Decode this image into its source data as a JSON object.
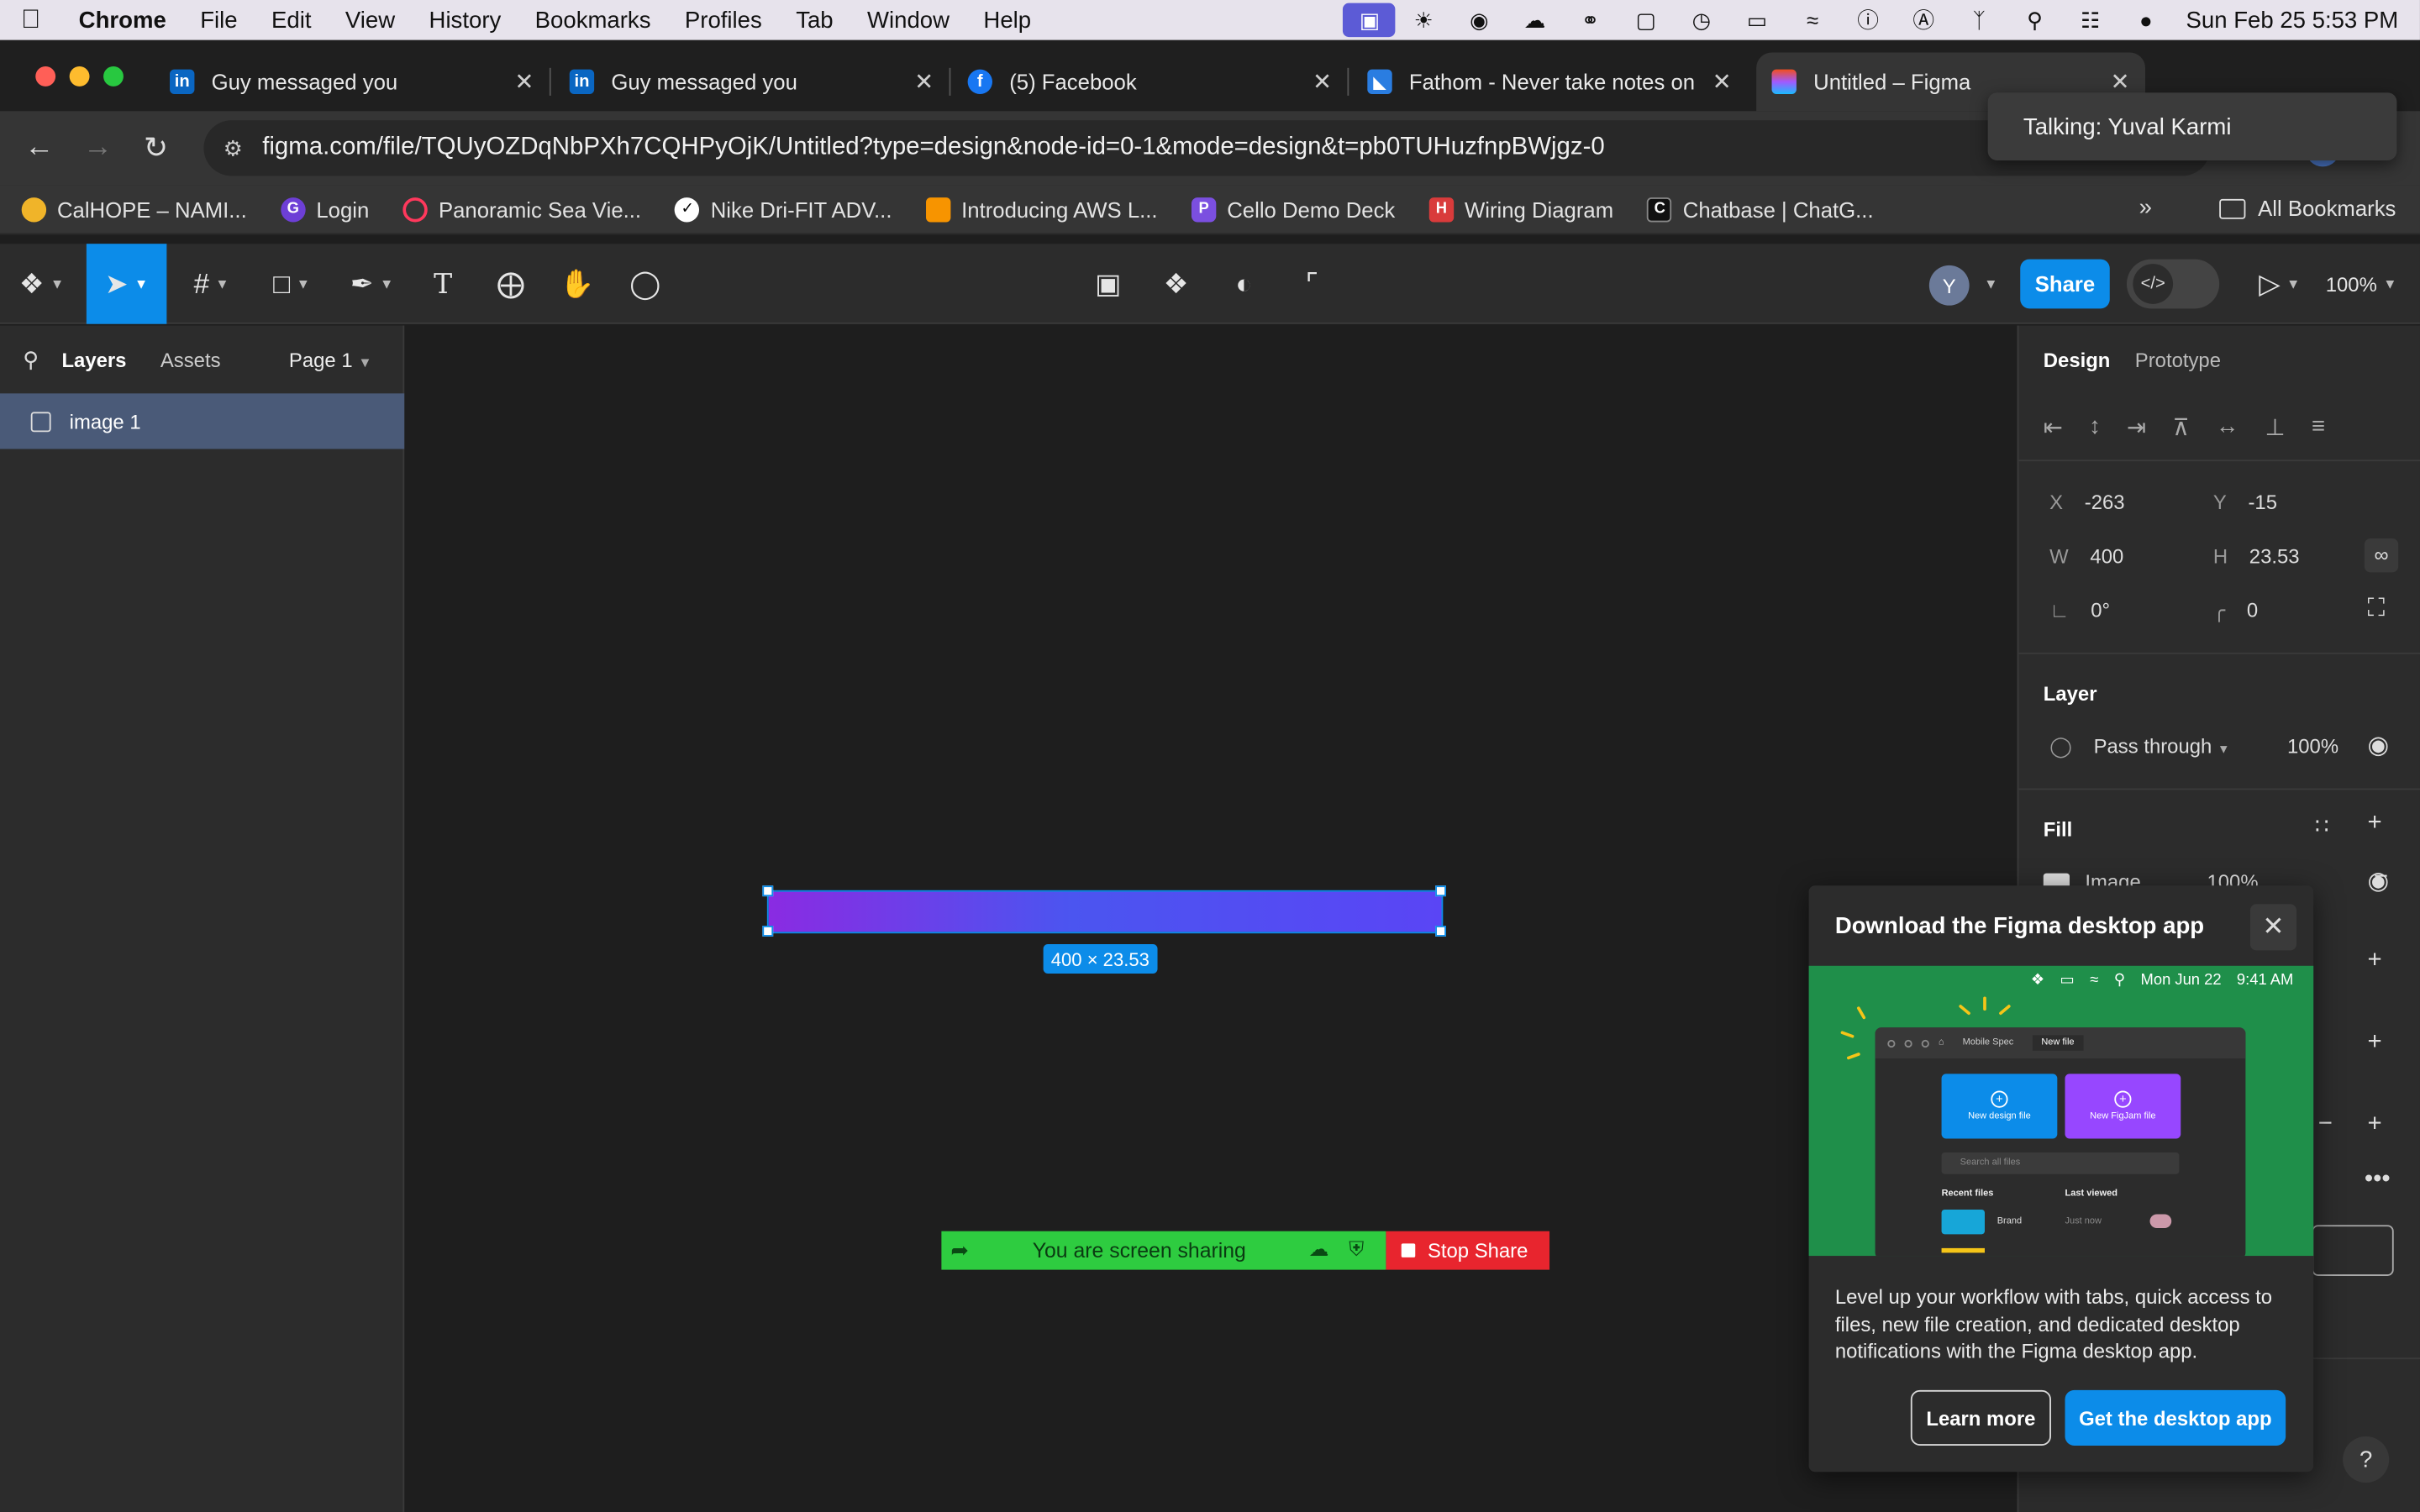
{
  "menubar": {
    "app": "Chrome",
    "items": [
      "File",
      "Edit",
      "View",
      "History",
      "Bookmarks",
      "Profiles",
      "Tab",
      "Window",
      "Help"
    ],
    "clock": "Sun Feb 25  5:53 PM",
    "tray_icons": [
      "screen-share-icon",
      "sun-icon",
      "fathom-icon",
      "weather-icon",
      "headphones-icon",
      "square-icon",
      "clock-icon",
      "battery-icon",
      "wifi-icon",
      "info-icon",
      "keyboard-a-icon",
      "bluetooth-icon",
      "search-icon",
      "control-center-icon",
      "siri-icon"
    ]
  },
  "tabs": [
    {
      "title": "Guy messaged you",
      "favicon": "linkedin-icon",
      "color": "#0a66c2"
    },
    {
      "title": "Guy messaged you",
      "favicon": "linkedin-icon",
      "color": "#0a66c2"
    },
    {
      "title": "(5) Facebook",
      "favicon": "facebook-icon",
      "color": "#1877f2"
    },
    {
      "title": "Fathom - Never take notes on",
      "favicon": "fathom-icon",
      "color": "#2a7de1"
    },
    {
      "title": "Untitled – Figma",
      "favicon": "figma-icon",
      "color": "#f24e1e"
    }
  ],
  "address": {
    "url": "figma.com/file/TQUyOZDqNbPXh7CQHPyOjK/Untitled?type=design&node-id=0-1&mode=design&t=pb0TUHuzfnpBWjgz-0"
  },
  "bookmarks": {
    "items": [
      {
        "label": "CalHOPE – NAMI...",
        "color": "#f0b429"
      },
      {
        "label": "Login",
        "color": "#6d3fd6"
      },
      {
        "label": "Panoramic Sea Vie...",
        "color": "#ff385c"
      },
      {
        "label": "Nike Dri-FIT ADV...",
        "color": "#ffffff"
      },
      {
        "label": "Introducing AWS L...",
        "color": "#f79400"
      },
      {
        "label": "Cello Demo Deck",
        "color": "#7b4fe0"
      },
      {
        "label": "Wiring Diagram",
        "color": "#d93b3b"
      },
      {
        "label": "Chatbase | ChatG...",
        "color": "#111111"
      }
    ],
    "overflow": "»",
    "all_bookmarks": "All Bookmarks"
  },
  "toast": {
    "text": "Talking: Yuval Karmi"
  },
  "figma_toolbar": {
    "share_label": "Share",
    "avatar_letter": "Y",
    "zoom": "100%"
  },
  "left_panel": {
    "tab_layers": "Layers",
    "tab_assets": "Assets",
    "page": "Page 1",
    "layers": [
      {
        "name": "image 1"
      }
    ]
  },
  "canvas": {
    "dimension_badge": "400 × 23.53",
    "screenshare_text": "You are screen sharing",
    "stop_share": "Stop Share"
  },
  "right_panel": {
    "tab_design": "Design",
    "tab_prototype": "Prototype",
    "x": "-263",
    "y": "-15",
    "w": "400",
    "h": "23.53",
    "rotation": "0°",
    "radius": "0",
    "layer_title": "Layer",
    "blend_mode": "Pass through",
    "opacity": "100%",
    "fill_title": "Fill",
    "fill_type": "Image",
    "fill_opacity": "100%"
  },
  "popup": {
    "title": "Download the Figma desktop app",
    "body": "Level up your workflow with tabs, quick access to files, new file creation, and dedicated desktop notifications with the Figma desktop app.",
    "learn_more": "Learn more",
    "get_app": "Get the desktop app",
    "hero": {
      "date": "Mon Jun 22",
      "time": "9:41 AM",
      "tab1": "Mobile Spec",
      "tab2": "New file",
      "card1": "New design file",
      "card2": "New FigJam file",
      "search": "Search all files",
      "recent": "Recent files",
      "last_viewed": "Last viewed",
      "file": "Brand",
      "when": "Just now"
    }
  }
}
